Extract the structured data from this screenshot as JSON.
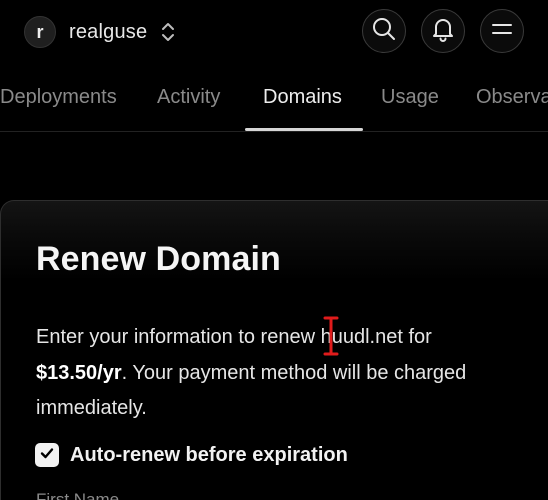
{
  "header": {
    "team_avatar_letter": "r",
    "team_name": "realguse",
    "icons": {
      "team_switcher": "chevron-up-down-icon",
      "search": "search-icon",
      "notifications": "bell-icon",
      "menu": "menu-icon"
    }
  },
  "tabs": [
    {
      "label": "Deployments",
      "active": false
    },
    {
      "label": "Activity",
      "active": false
    },
    {
      "label": "Domains",
      "active": true
    },
    {
      "label": "Usage",
      "active": false
    },
    {
      "label": "Observa",
      "active": false
    }
  ],
  "dialog": {
    "title": "Renew Domain",
    "description_prefix": "Enter your information to renew ",
    "domain": "huudl.net",
    "description_mid": " for",
    "price": "$13.50/yr",
    "description_suffix": ". Your payment method will be charged immediately.",
    "auto_renew_label": "Auto-renew before expiration",
    "auto_renew_checked": true,
    "first_field_label": "First Name"
  },
  "colors": {
    "background": "#000000",
    "text_primary": "#ffffff",
    "text_muted": "#8a8a8a",
    "cursor": "#e01b1b"
  }
}
